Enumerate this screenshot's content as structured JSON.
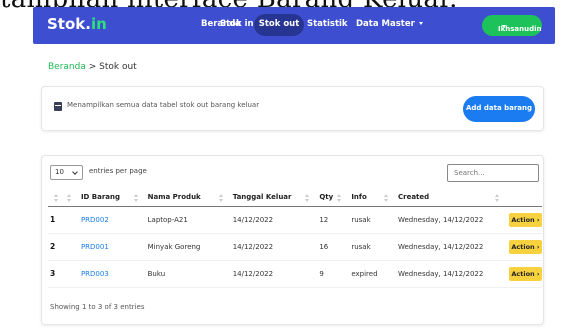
{
  "caption": "tampilan interface Barang Keluar.",
  "navbar": {
    "brand_main": "Stok.",
    "brand_accent": "in",
    "items": [
      {
        "label": "Beranda"
      },
      {
        "label": "Stok in"
      },
      {
        "label": "Stok out"
      },
      {
        "label": "Statistik"
      },
      {
        "label": "Data Master"
      }
    ],
    "active": "Stok out",
    "user": "Ikhsanudin",
    "colors": {
      "bar": "#3e4ed0",
      "active": "#263592",
      "user": "#1ec25a",
      "accent": "#2ee07a"
    }
  },
  "breadcrumb": {
    "link": "Beranda",
    "separator": " > ",
    "current": "Stok out"
  },
  "info": {
    "text": "Menampilkan semua data tabel stok out barang keluar",
    "add_label": "Add data barang"
  },
  "table": {
    "length_value": "10",
    "length_label": "entries per page",
    "search_placeholder": "Search...",
    "columns": [
      "ID Barang",
      "Nama Produk",
      "Tanggal Keluar",
      "Qty",
      "Info",
      "Created"
    ],
    "rows": [
      {
        "num": "1",
        "id": "PRD002",
        "nama": "Laptop-A21",
        "tanggal": "14/12/2022",
        "qty": "12",
        "info": "rusak",
        "created": "Wednesday, 14/12/2022",
        "action": "Action ›"
      },
      {
        "num": "2",
        "id": "PRD001",
        "nama": "Minyak Goreng",
        "tanggal": "14/12/2022",
        "qty": "16",
        "info": "rusak",
        "created": "Wednesday, 14/12/2022",
        "action": "Action ›"
      },
      {
        "num": "3",
        "id": "PRD003",
        "nama": "Buku",
        "tanggal": "14/12/2022",
        "qty": "9",
        "info": "expired",
        "created": "Wednesday, 14/12/2022",
        "action": "Action ›"
      }
    ],
    "footer": "Showing 1 to 3 of 3 entries"
  }
}
